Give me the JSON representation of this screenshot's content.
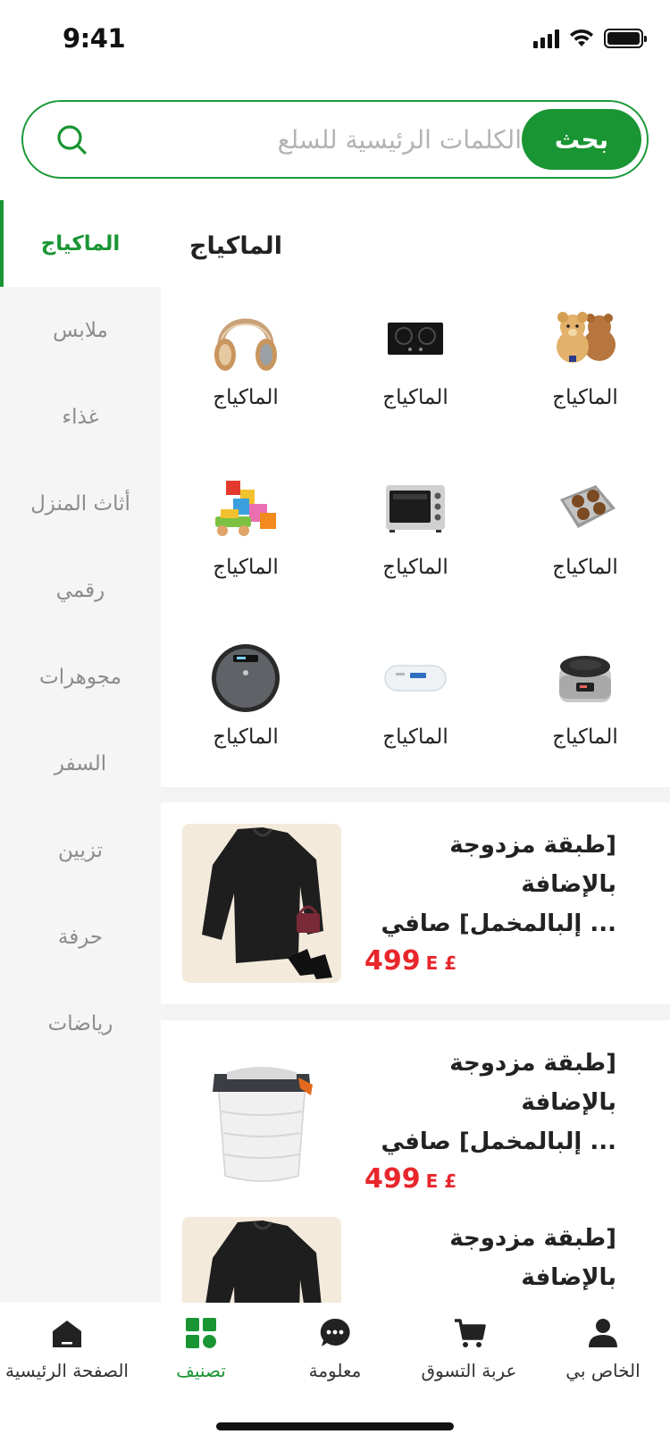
{
  "status": {
    "time": "9:41"
  },
  "search": {
    "placeholder": "الكلمات الرئيسية للسلع",
    "button": "بحث"
  },
  "sidebar": {
    "items": [
      {
        "label": "الماكياج",
        "active": true
      },
      {
        "label": "ملابس"
      },
      {
        "label": "غذاء"
      },
      {
        "label": "أثاث المنزل"
      },
      {
        "label": "رقمي"
      },
      {
        "label": "مجوهرات"
      },
      {
        "label": "السفر"
      },
      {
        "label": "تزيين"
      },
      {
        "label": "حرفة"
      },
      {
        "label": "رياضات"
      }
    ]
  },
  "category": {
    "title": "الماكياج",
    "items": [
      {
        "label": "الماكياج",
        "icon": "headphones-image"
      },
      {
        "label": "الماكياج",
        "icon": "gas-stove-image"
      },
      {
        "label": "الماكياج",
        "icon": "teddy-bears-image"
      },
      {
        "label": "الماكياج",
        "icon": "toy-blocks-image"
      },
      {
        "label": "الماكياج",
        "icon": "oven-image"
      },
      {
        "label": "الماكياج",
        "icon": "bath-heater-image"
      },
      {
        "label": "الماكياج",
        "icon": "robot-vacuum-image"
      },
      {
        "label": "الماكياج",
        "icon": "water-heater-image"
      },
      {
        "label": "الماكياج",
        "icon": "rice-cooker-image"
      }
    ]
  },
  "products": [
    {
      "title_line1": "[طبقة مزدوجة بالإضافة",
      "title_line2": "... إلبالمخمل] صافي",
      "price": "499",
      "currency": "E £",
      "image": "black-blouse-image"
    },
    {
      "title_line1": "[طبقة مزدوجة بالإضافة",
      "title_line2": "... إلبالمخمل] صافي",
      "price": "499",
      "currency": "E £",
      "image": "folding-washer-image"
    },
    {
      "title_line1": "[طبقة مزدوجة بالإضافة",
      "image": "black-blouse-image"
    }
  ],
  "tabbar": {
    "items": [
      {
        "label": "الصفحة الرئيسية",
        "icon": "home-icon"
      },
      {
        "label": "تصنيف",
        "icon": "category-icon",
        "active": true
      },
      {
        "label": "معلومة",
        "icon": "message-icon"
      },
      {
        "label": "عربة التسوق",
        "icon": "cart-icon"
      },
      {
        "label": "الخاص بي",
        "icon": "user-icon"
      }
    ]
  },
  "colors": {
    "accent": "#1a9534",
    "price": "#e8262b",
    "sidebar_bg": "#f5f5f5",
    "text_muted": "#8c8c8c"
  }
}
